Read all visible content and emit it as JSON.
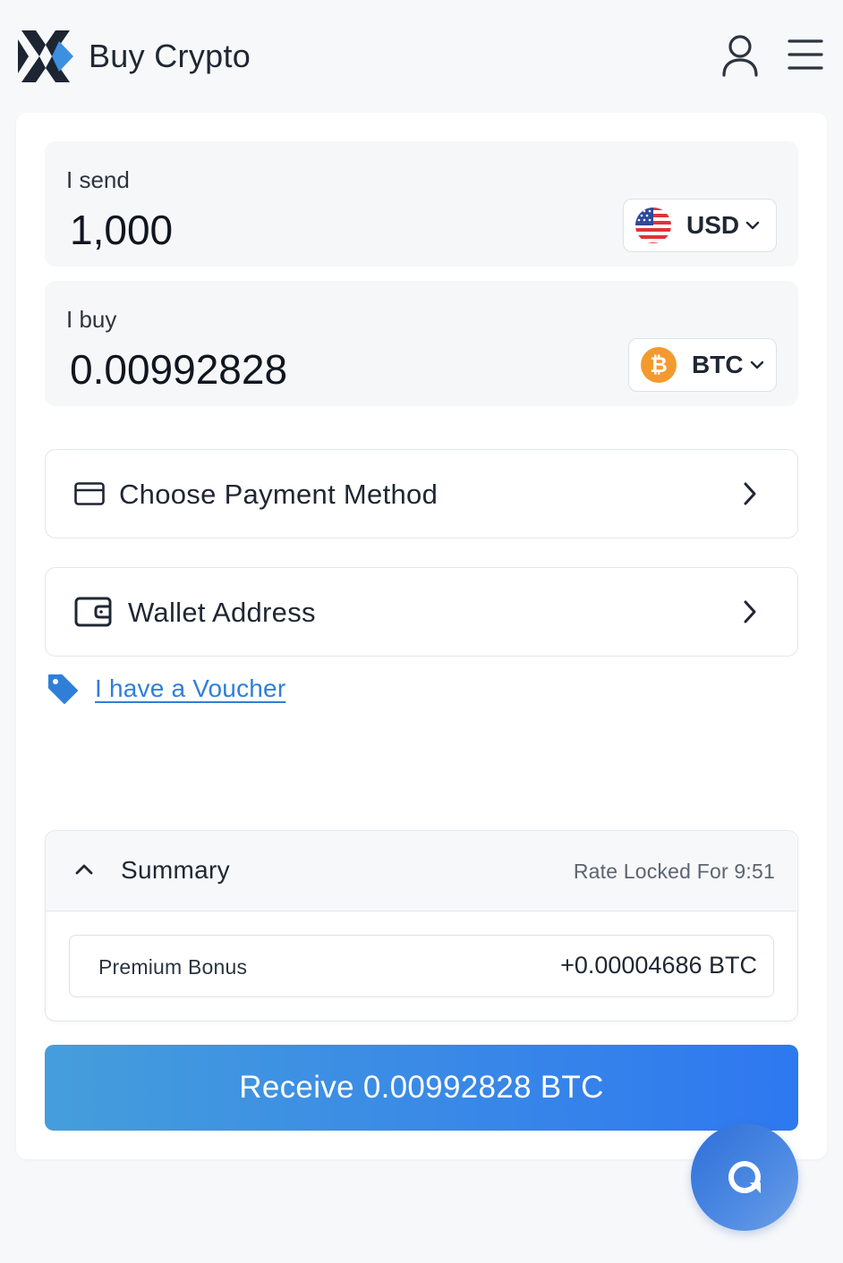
{
  "header": {
    "title": "Buy Crypto",
    "logo_icon": "changelly-x-logo",
    "user_icon": "user-icon",
    "menu_icon": "hamburger-menu-icon"
  },
  "send": {
    "label": "I send",
    "amount": "1,000",
    "currency": "USD",
    "currency_icon": "us-flag-icon"
  },
  "buy": {
    "label": "I buy",
    "amount": "0.00992828",
    "currency": "BTC",
    "currency_icon": "bitcoin-icon"
  },
  "payment": {
    "label": "Choose Payment Method",
    "icon": "credit-card-icon"
  },
  "wallet": {
    "label": "Wallet Address",
    "icon": "wallet-icon"
  },
  "voucher": {
    "label": "I have a Voucher",
    "icon": "tag-icon"
  },
  "summary": {
    "title": "Summary",
    "rate_locked": "Rate Locked For 9:51",
    "bonus_label": "Premium Bonus",
    "bonus_value": "+0.00004686 BTC"
  },
  "cta": {
    "label": "Receive 0.00992828 BTC"
  },
  "chat": {
    "icon": "chat-support-icon"
  },
  "colors": {
    "accent": "#2f7fd9",
    "bitcoin": "#f39a2f",
    "logo_dark": "#1d2533",
    "logo_blue": "#3d8fe0"
  }
}
